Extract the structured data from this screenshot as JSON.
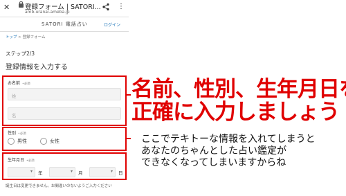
{
  "browser": {
    "close_icon": "close-icon",
    "title": "登録フォーム | SATORI...",
    "url": "amb-uranai.ameba.jp"
  },
  "header": {
    "logo": "SATORI 電話占い",
    "login": "ログイン"
  },
  "breadcrumb": {
    "home": "トップ",
    "separator": ">",
    "current": "登録フォーム"
  },
  "form": {
    "step": "ステップ2/3",
    "heading": "登録情報を入力する",
    "required": "•必須",
    "name": {
      "label": "お名前",
      "last_placeholder": "姓",
      "first_placeholder": "名"
    },
    "gender": {
      "label": "性別",
      "options": [
        "男性",
        "女性"
      ]
    },
    "dob": {
      "label": "生年月日",
      "units": [
        "年",
        "月",
        "日"
      ]
    },
    "note": "誕生日は変更できません。お間違いのないようご入力ください"
  },
  "annotation": {
    "headline_line1": "名前、性別、生年月日を",
    "headline_line2": "正確に入力しましょう",
    "body_line1": "ここでテキトーな情報を入れてしまうと",
    "body_line2": "あなたのちゃんとした占い鑑定が",
    "body_line3": "できなくなってしまいますからね"
  },
  "colors": {
    "highlight": "#e00000",
    "link": "#1a73b8"
  }
}
